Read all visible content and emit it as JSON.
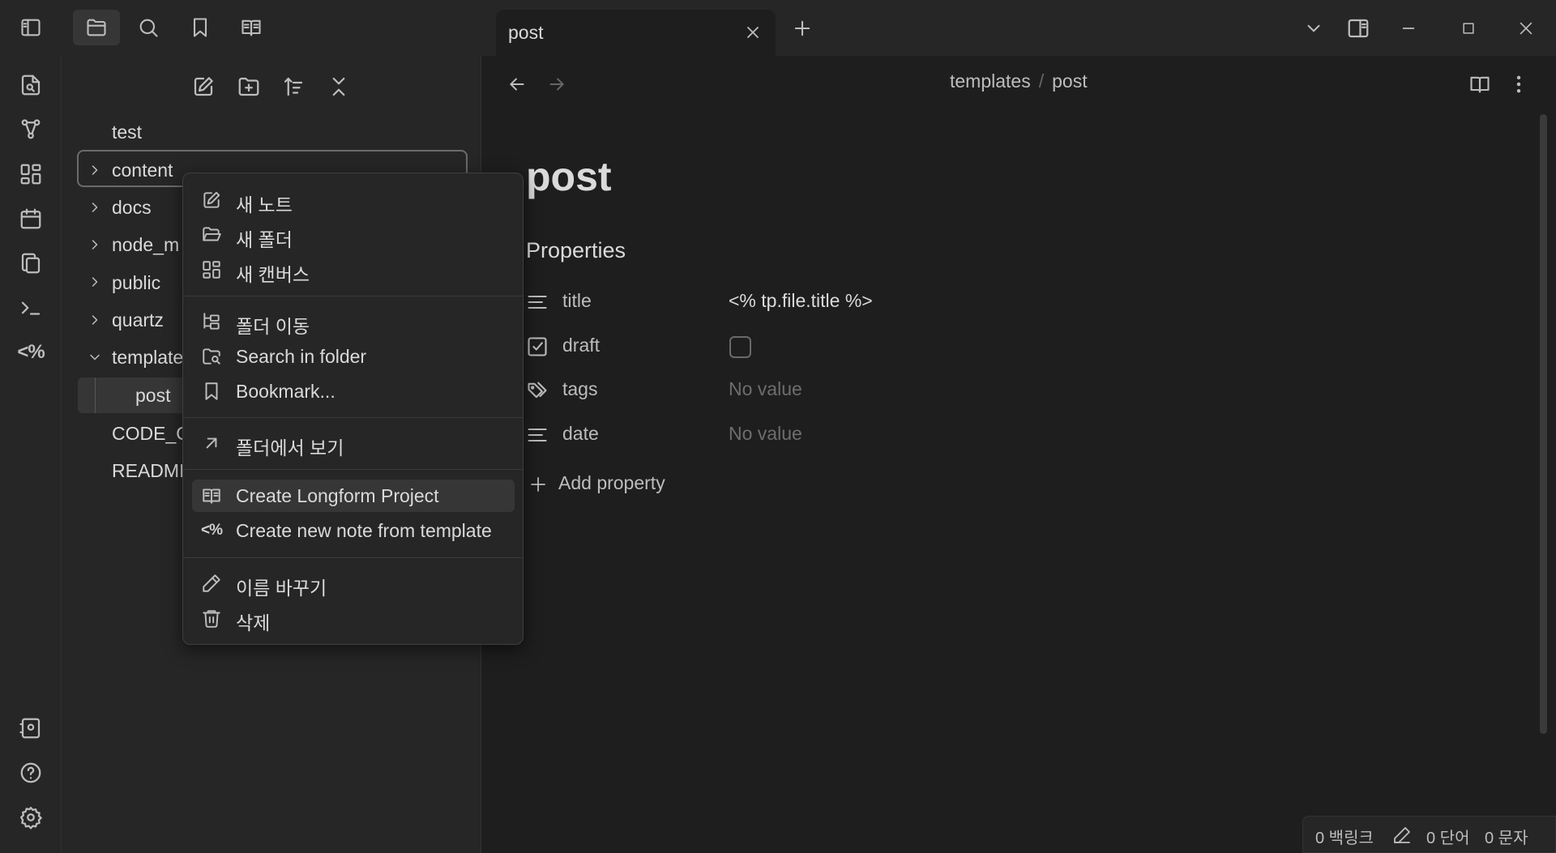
{
  "tab": {
    "title": "post"
  },
  "explorer": {
    "items": [
      {
        "label": "test"
      },
      {
        "label": "content"
      },
      {
        "label": "docs"
      },
      {
        "label": "node_m"
      },
      {
        "label": "public"
      },
      {
        "label": "quartz"
      },
      {
        "label": "template"
      },
      {
        "label": "post"
      },
      {
        "label": "CODE_O"
      },
      {
        "label": "READMI"
      }
    ]
  },
  "editor": {
    "breadcrumb": {
      "folder": "templates",
      "separator": "/",
      "file": "post"
    },
    "doc_title": "post",
    "properties_heading": "Properties",
    "properties": [
      {
        "key": "title",
        "value": "<% tp.file.title %>",
        "icon": "text-lines-icon"
      },
      {
        "key": "draft",
        "value": "",
        "icon": "checkbox-icon",
        "checked": false
      },
      {
        "key": "tags",
        "value": "No value",
        "icon": "tags-icon"
      },
      {
        "key": "date",
        "value": "No value",
        "icon": "text-lines-icon"
      }
    ],
    "add_property": "Add property"
  },
  "context_menu": {
    "items": [
      {
        "label": "새 노트",
        "icon": "edit-icon"
      },
      {
        "label": "새 폴더",
        "icon": "folder-open-icon"
      },
      {
        "label": "새 캔버스",
        "icon": "canvas-icon"
      },
      {
        "label": "폴더 이동",
        "icon": "folder-tree-icon"
      },
      {
        "label": "Search in folder",
        "icon": "folder-search-icon"
      },
      {
        "label": "Bookmark...",
        "icon": "bookmark-icon"
      },
      {
        "label": "폴더에서 보기",
        "icon": "arrow-up-right-icon"
      },
      {
        "label": "Create Longform Project",
        "icon": "book-icon",
        "highlighted": true
      },
      {
        "label": "Create new note from template",
        "icon": "templater-icon",
        "icon_text": "<%"
      },
      {
        "label": "이름 바꾸기",
        "icon": "pencil-icon"
      },
      {
        "label": "삭제",
        "icon": "trash-icon"
      }
    ]
  },
  "ribbon": {
    "templater_text": "<%"
  },
  "status": {
    "backlinks": "0 백링크",
    "words": "0 단어",
    "chars": "0 문자"
  }
}
